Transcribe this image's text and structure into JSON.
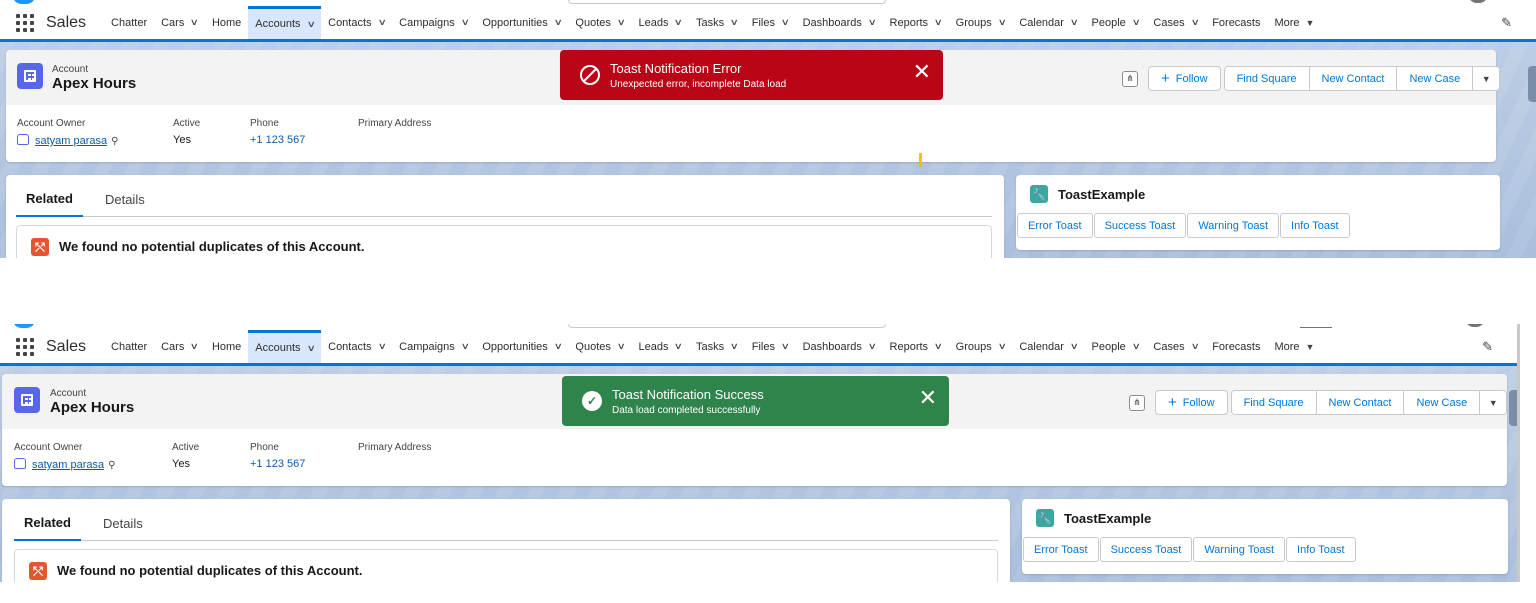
{
  "screens": [
    {
      "nav": {
        "app_name": "Sales",
        "items": [
          {
            "label": "Chatter",
            "chevron": false
          },
          {
            "label": "Cars",
            "chevron": true
          },
          {
            "label": "Home",
            "chevron": false
          },
          {
            "label": "Accounts",
            "chevron": true,
            "active": true
          },
          {
            "label": "Contacts",
            "chevron": true
          },
          {
            "label": "Campaigns",
            "chevron": true
          },
          {
            "label": "Opportunities",
            "chevron": true
          },
          {
            "label": "Quotes",
            "chevron": true
          },
          {
            "label": "Leads",
            "chevron": true
          },
          {
            "label": "Tasks",
            "chevron": true
          },
          {
            "label": "Files",
            "chevron": true
          },
          {
            "label": "Dashboards",
            "chevron": true
          },
          {
            "label": "Reports",
            "chevron": true
          },
          {
            "label": "Groups",
            "chevron": true
          },
          {
            "label": "Calendar",
            "chevron": true
          },
          {
            "label": "People",
            "chevron": true
          },
          {
            "label": "Cases",
            "chevron": true
          },
          {
            "label": "Forecasts",
            "chevron": false
          }
        ],
        "more_label": "More"
      },
      "record": {
        "object_label": "Account",
        "name": "Apex Hours",
        "actions": {
          "follow": "Follow",
          "buttons": [
            "Find Square",
            "New Contact",
            "New Case"
          ]
        },
        "fields": {
          "owner_label": "Account Owner",
          "owner_value": "satyam parasa",
          "active_label": "Active",
          "active_value": "Yes",
          "phone_label": "Phone",
          "phone_value": "+1 123 567",
          "address_label": "Primary Address"
        }
      },
      "toast": {
        "variant": "error",
        "title": "Toast Notification Error",
        "message": "Unexpected error, incomplete Data load",
        "color": "#ba0517"
      },
      "related": {
        "tabs": [
          "Related",
          "Details"
        ],
        "active_tab": "Related",
        "duplicates_message": "We found no potential duplicates of this Account."
      },
      "toast_example": {
        "title": "ToastExample",
        "buttons": [
          "Error Toast",
          "Success Toast",
          "Warning Toast",
          "Info Toast"
        ]
      }
    },
    {
      "nav": {
        "app_name": "Sales",
        "items": [
          {
            "label": "Chatter",
            "chevron": false
          },
          {
            "label": "Cars",
            "chevron": true
          },
          {
            "label": "Home",
            "chevron": false
          },
          {
            "label": "Accounts",
            "chevron": true,
            "active": true
          },
          {
            "label": "Contacts",
            "chevron": true
          },
          {
            "label": "Campaigns",
            "chevron": true
          },
          {
            "label": "Opportunities",
            "chevron": true
          },
          {
            "label": "Quotes",
            "chevron": true
          },
          {
            "label": "Leads",
            "chevron": true
          },
          {
            "label": "Tasks",
            "chevron": true
          },
          {
            "label": "Files",
            "chevron": true
          },
          {
            "label": "Dashboards",
            "chevron": true
          },
          {
            "label": "Reports",
            "chevron": true
          },
          {
            "label": "Groups",
            "chevron": true
          },
          {
            "label": "Calendar",
            "chevron": true
          },
          {
            "label": "People",
            "chevron": true
          },
          {
            "label": "Cases",
            "chevron": true
          },
          {
            "label": "Forecasts",
            "chevron": false
          }
        ],
        "more_label": "More"
      },
      "record": {
        "object_label": "Account",
        "name": "Apex Hours",
        "actions": {
          "follow": "Follow",
          "buttons": [
            "Find Square",
            "New Contact",
            "New Case"
          ]
        },
        "fields": {
          "owner_label": "Account Owner",
          "owner_value": "satyam parasa",
          "active_label": "Active",
          "active_value": "Yes",
          "phone_label": "Phone",
          "phone_value": "+1 123 567",
          "address_label": "Primary Address"
        }
      },
      "toast": {
        "variant": "success",
        "title": "Toast Notification Success",
        "message": "Data load completed successfully",
        "color": "#2e844a"
      },
      "related": {
        "tabs": [
          "Related",
          "Details"
        ],
        "active_tab": "Related",
        "duplicates_message": "We found no potential duplicates of this Account."
      },
      "toast_example": {
        "title": "ToastExample",
        "buttons": [
          "Error Toast",
          "Success Toast",
          "Warning Toast",
          "Info Toast"
        ]
      }
    }
  ],
  "icons": {
    "app_launcher": "waffle-icon",
    "nav_chevron": "chevron-down-icon",
    "edit_nav": "pencil-icon",
    "account": "account-icon",
    "hierarchy": "hierarchy-icon",
    "follow": "plus-icon",
    "error": "ban-icon",
    "success": "check-circle-icon",
    "close": "close-icon",
    "duplicates": "duplicate-icon",
    "toast_component": "wrench-icon"
  }
}
